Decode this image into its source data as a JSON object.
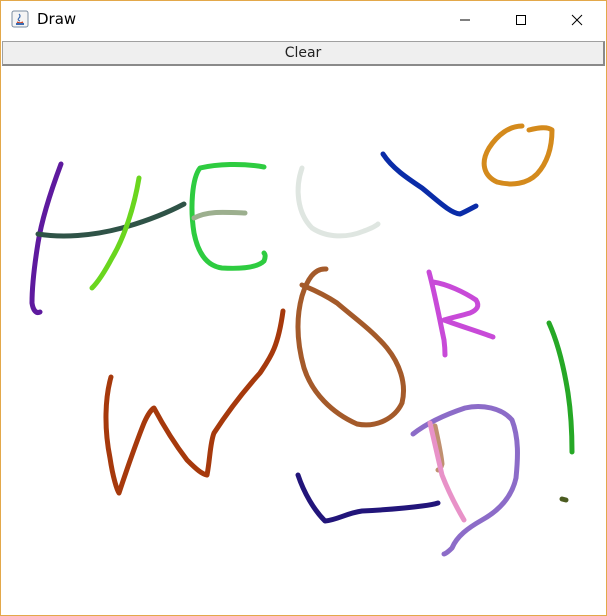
{
  "window": {
    "title": "Draw",
    "icon": "java-app-icon",
    "controls": [
      "minimize-icon",
      "maximize-icon",
      "close-icon"
    ]
  },
  "toolbar": {
    "clear_label": "Clear"
  },
  "canvas": {
    "background": "#ffffff",
    "strokes": [
      {
        "color": "#5e1a9e"
      },
      {
        "color": "#2f5347"
      },
      {
        "color": "#6ad61e"
      },
      {
        "color": "#2ecc40"
      },
      {
        "color": "#9caf8e"
      },
      {
        "color": "#dfe6e1"
      },
      {
        "color": "#0a2ca8"
      },
      {
        "color": "#d48a1c"
      },
      {
        "color": "#a6390c"
      },
      {
        "color": "#a45a2a"
      },
      {
        "color": "#c84ad8"
      },
      {
        "color": "#26a826"
      },
      {
        "color": "#4b5b20"
      },
      {
        "color": "#8c6cc8"
      },
      {
        "color": "#c09070"
      },
      {
        "color": "#e892c8"
      },
      {
        "color": "#22157a"
      }
    ]
  }
}
